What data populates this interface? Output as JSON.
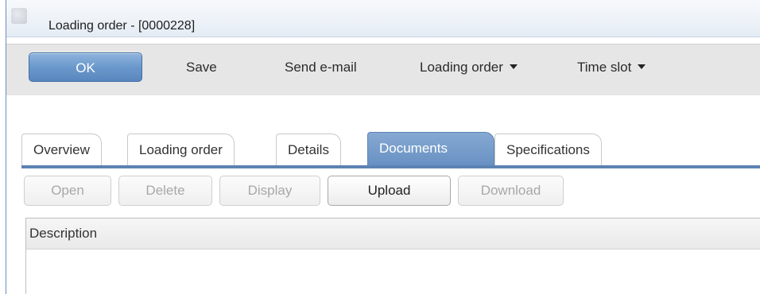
{
  "window": {
    "title": "Loading order - [0000228]"
  },
  "toolbar": {
    "ok_label": "OK",
    "save_label": "Save",
    "send_email_label": "Send e-mail",
    "loading_order_menu_label": "Loading order",
    "time_slot_menu_label": "Time slot"
  },
  "tabs": [
    {
      "label": "Overview",
      "active": false
    },
    {
      "label": "Loading order",
      "active": false
    },
    {
      "label": "Details",
      "active": false
    },
    {
      "label": "Documents",
      "active": true
    },
    {
      "label": "Specifications",
      "active": false
    }
  ],
  "actions": {
    "open_label": "Open",
    "delete_label": "Delete",
    "display_label": "Display",
    "upload_label": "Upload",
    "download_label": "Download"
  },
  "grid": {
    "columns": [
      "Description"
    ],
    "rows": []
  },
  "colors": {
    "accent": "#6891c3",
    "toolbar_bg": "#e6e6e6",
    "disabled_text": "#a8a8a8"
  }
}
